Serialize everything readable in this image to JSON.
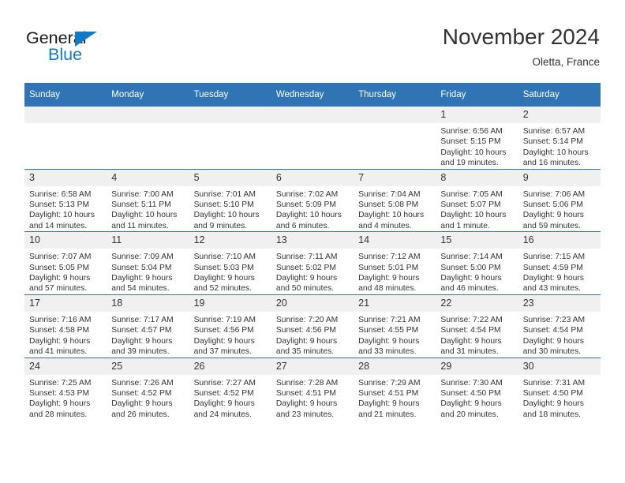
{
  "brand": {
    "name_part1": "General",
    "name_part2": "Blue",
    "accent_color": "#1479c4"
  },
  "header": {
    "title": "November 2024",
    "location": "Oletta, France",
    "header_bg_color": "#2f74b5",
    "daynum_bg_color": "#f0f0f0"
  },
  "weekdays": [
    "Sunday",
    "Monday",
    "Tuesday",
    "Wednesday",
    "Thursday",
    "Friday",
    "Saturday"
  ],
  "weeks": [
    [
      {
        "day": "",
        "blank": true
      },
      {
        "day": "",
        "blank": true
      },
      {
        "day": "",
        "blank": true
      },
      {
        "day": "",
        "blank": true
      },
      {
        "day": "",
        "blank": true
      },
      {
        "day": "1",
        "sunrise": "Sunrise: 6:56 AM",
        "sunset": "Sunset: 5:15 PM",
        "daylight_line1": "Daylight: 10 hours",
        "daylight_line2": "and 19 minutes."
      },
      {
        "day": "2",
        "sunrise": "Sunrise: 6:57 AM",
        "sunset": "Sunset: 5:14 PM",
        "daylight_line1": "Daylight: 10 hours",
        "daylight_line2": "and 16 minutes."
      }
    ],
    [
      {
        "day": "3",
        "sunrise": "Sunrise: 6:58 AM",
        "sunset": "Sunset: 5:13 PM",
        "daylight_line1": "Daylight: 10 hours",
        "daylight_line2": "and 14 minutes."
      },
      {
        "day": "4",
        "sunrise": "Sunrise: 7:00 AM",
        "sunset": "Sunset: 5:11 PM",
        "daylight_line1": "Daylight: 10 hours",
        "daylight_line2": "and 11 minutes."
      },
      {
        "day": "5",
        "sunrise": "Sunrise: 7:01 AM",
        "sunset": "Sunset: 5:10 PM",
        "daylight_line1": "Daylight: 10 hours",
        "daylight_line2": "and 9 minutes."
      },
      {
        "day": "6",
        "sunrise": "Sunrise: 7:02 AM",
        "sunset": "Sunset: 5:09 PM",
        "daylight_line1": "Daylight: 10 hours",
        "daylight_line2": "and 6 minutes."
      },
      {
        "day": "7",
        "sunrise": "Sunrise: 7:04 AM",
        "sunset": "Sunset: 5:08 PM",
        "daylight_line1": "Daylight: 10 hours",
        "daylight_line2": "and 4 minutes."
      },
      {
        "day": "8",
        "sunrise": "Sunrise: 7:05 AM",
        "sunset": "Sunset: 5:07 PM",
        "daylight_line1": "Daylight: 10 hours",
        "daylight_line2": "and 1 minute."
      },
      {
        "day": "9",
        "sunrise": "Sunrise: 7:06 AM",
        "sunset": "Sunset: 5:06 PM",
        "daylight_line1": "Daylight: 9 hours",
        "daylight_line2": "and 59 minutes."
      }
    ],
    [
      {
        "day": "10",
        "sunrise": "Sunrise: 7:07 AM",
        "sunset": "Sunset: 5:05 PM",
        "daylight_line1": "Daylight: 9 hours",
        "daylight_line2": "and 57 minutes."
      },
      {
        "day": "11",
        "sunrise": "Sunrise: 7:09 AM",
        "sunset": "Sunset: 5:04 PM",
        "daylight_line1": "Daylight: 9 hours",
        "daylight_line2": "and 54 minutes."
      },
      {
        "day": "12",
        "sunrise": "Sunrise: 7:10 AM",
        "sunset": "Sunset: 5:03 PM",
        "daylight_line1": "Daylight: 9 hours",
        "daylight_line2": "and 52 minutes."
      },
      {
        "day": "13",
        "sunrise": "Sunrise: 7:11 AM",
        "sunset": "Sunset: 5:02 PM",
        "daylight_line1": "Daylight: 9 hours",
        "daylight_line2": "and 50 minutes."
      },
      {
        "day": "14",
        "sunrise": "Sunrise: 7:12 AM",
        "sunset": "Sunset: 5:01 PM",
        "daylight_line1": "Daylight: 9 hours",
        "daylight_line2": "and 48 minutes."
      },
      {
        "day": "15",
        "sunrise": "Sunrise: 7:14 AM",
        "sunset": "Sunset: 5:00 PM",
        "daylight_line1": "Daylight: 9 hours",
        "daylight_line2": "and 46 minutes."
      },
      {
        "day": "16",
        "sunrise": "Sunrise: 7:15 AM",
        "sunset": "Sunset: 4:59 PM",
        "daylight_line1": "Daylight: 9 hours",
        "daylight_line2": "and 43 minutes."
      }
    ],
    [
      {
        "day": "17",
        "sunrise": "Sunrise: 7:16 AM",
        "sunset": "Sunset: 4:58 PM",
        "daylight_line1": "Daylight: 9 hours",
        "daylight_line2": "and 41 minutes."
      },
      {
        "day": "18",
        "sunrise": "Sunrise: 7:17 AM",
        "sunset": "Sunset: 4:57 PM",
        "daylight_line1": "Daylight: 9 hours",
        "daylight_line2": "and 39 minutes."
      },
      {
        "day": "19",
        "sunrise": "Sunrise: 7:19 AM",
        "sunset": "Sunset: 4:56 PM",
        "daylight_line1": "Daylight: 9 hours",
        "daylight_line2": "and 37 minutes."
      },
      {
        "day": "20",
        "sunrise": "Sunrise: 7:20 AM",
        "sunset": "Sunset: 4:56 PM",
        "daylight_line1": "Daylight: 9 hours",
        "daylight_line2": "and 35 minutes."
      },
      {
        "day": "21",
        "sunrise": "Sunrise: 7:21 AM",
        "sunset": "Sunset: 4:55 PM",
        "daylight_line1": "Daylight: 9 hours",
        "daylight_line2": "and 33 minutes."
      },
      {
        "day": "22",
        "sunrise": "Sunrise: 7:22 AM",
        "sunset": "Sunset: 4:54 PM",
        "daylight_line1": "Daylight: 9 hours",
        "daylight_line2": "and 31 minutes."
      },
      {
        "day": "23",
        "sunrise": "Sunrise: 7:23 AM",
        "sunset": "Sunset: 4:54 PM",
        "daylight_line1": "Daylight: 9 hours",
        "daylight_line2": "and 30 minutes."
      }
    ],
    [
      {
        "day": "24",
        "sunrise": "Sunrise: 7:25 AM",
        "sunset": "Sunset: 4:53 PM",
        "daylight_line1": "Daylight: 9 hours",
        "daylight_line2": "and 28 minutes."
      },
      {
        "day": "25",
        "sunrise": "Sunrise: 7:26 AM",
        "sunset": "Sunset: 4:52 PM",
        "daylight_line1": "Daylight: 9 hours",
        "daylight_line2": "and 26 minutes."
      },
      {
        "day": "26",
        "sunrise": "Sunrise: 7:27 AM",
        "sunset": "Sunset: 4:52 PM",
        "daylight_line1": "Daylight: 9 hours",
        "daylight_line2": "and 24 minutes."
      },
      {
        "day": "27",
        "sunrise": "Sunrise: 7:28 AM",
        "sunset": "Sunset: 4:51 PM",
        "daylight_line1": "Daylight: 9 hours",
        "daylight_line2": "and 23 minutes."
      },
      {
        "day": "28",
        "sunrise": "Sunrise: 7:29 AM",
        "sunset": "Sunset: 4:51 PM",
        "daylight_line1": "Daylight: 9 hours",
        "daylight_line2": "and 21 minutes."
      },
      {
        "day": "29",
        "sunrise": "Sunrise: 7:30 AM",
        "sunset": "Sunset: 4:50 PM",
        "daylight_line1": "Daylight: 9 hours",
        "daylight_line2": "and 20 minutes."
      },
      {
        "day": "30",
        "sunrise": "Sunrise: 7:31 AM",
        "sunset": "Sunset: 4:50 PM",
        "daylight_line1": "Daylight: 9 hours",
        "daylight_line2": "and 18 minutes."
      }
    ]
  ]
}
